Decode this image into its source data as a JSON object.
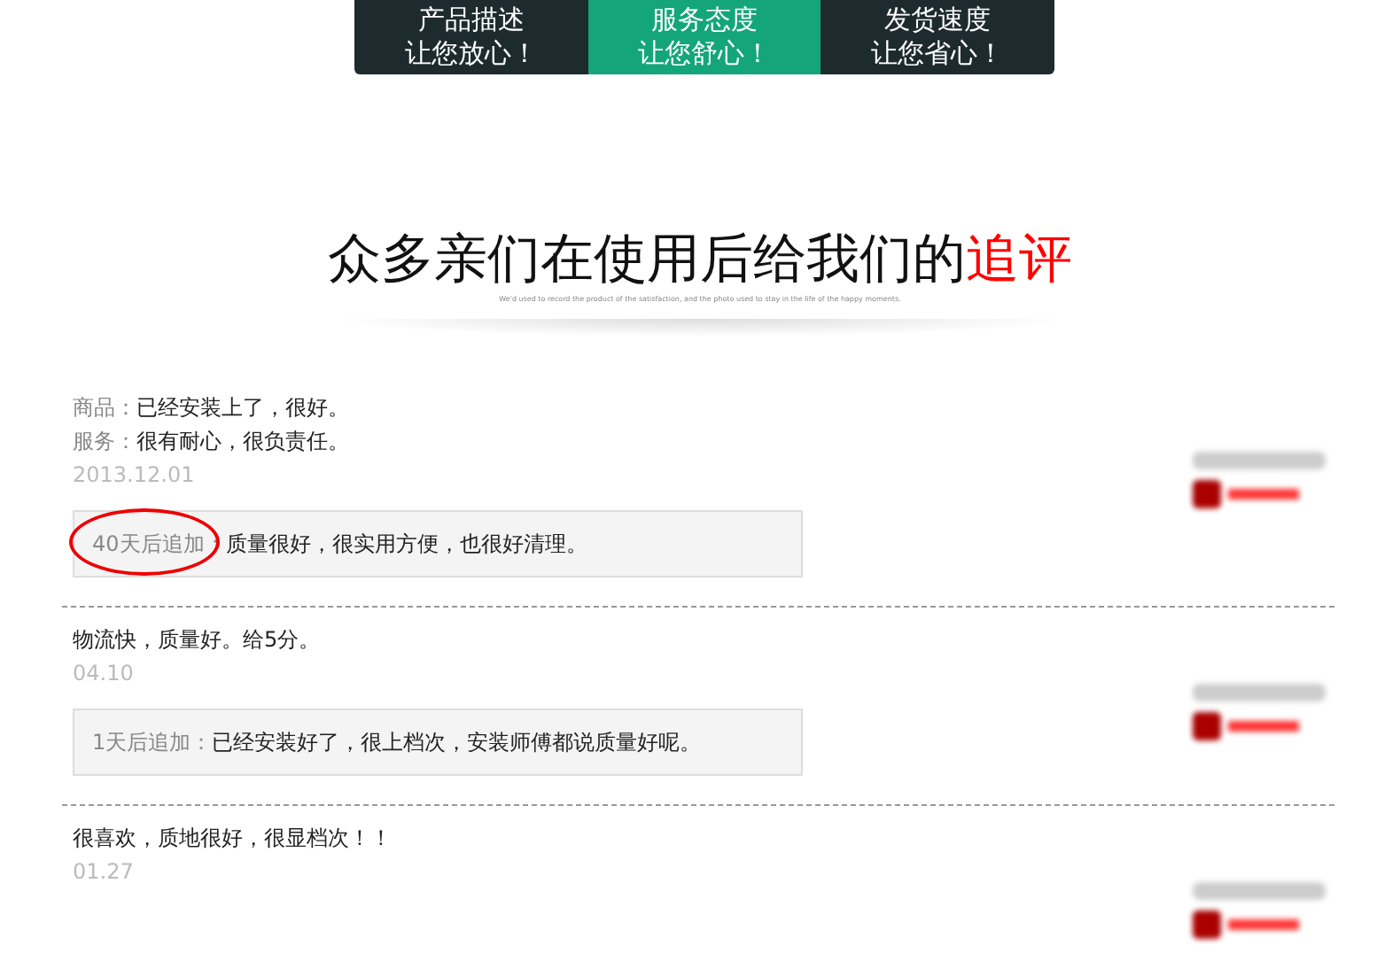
{
  "tabs": [
    {
      "line1": "产品描述",
      "line2": "让您放心！",
      "selected": false
    },
    {
      "line1": "服务态度",
      "line2": "让您舒心！",
      "selected": true
    },
    {
      "line1": "发货速度",
      "line2": "让您省心！",
      "selected": false
    }
  ],
  "heading": {
    "text": "众多亲们在使用后给我们的",
    "highlight": "追评",
    "subtitle": "We'd used to record the product of the satisfaction, and the photo used to stay in the life of the happy moments."
  },
  "reviews": [
    {
      "lines": [
        {
          "label": "商品：",
          "text": "已经安装上了，很好。"
        },
        {
          "label": "服务：",
          "text": "很有耐心，很负责任。"
        }
      ],
      "date": "2013.12.01",
      "followup": {
        "label": "40天后追加：",
        "text": "质量很好，很实用方便，也很好清理。",
        "circled": true
      }
    },
    {
      "lines": [
        {
          "text": "物流快，质量好。给5分。"
        }
      ],
      "date": "04.10",
      "followup": {
        "label": "1天后追加：",
        "text": "已经安装好了，很上档次，安装师傅都说质量好呢。",
        "circled": false
      }
    },
    {
      "lines": [
        {
          "text": "很喜欢，质地很好，很显档次！！"
        }
      ],
      "date": "01.27"
    }
  ]
}
